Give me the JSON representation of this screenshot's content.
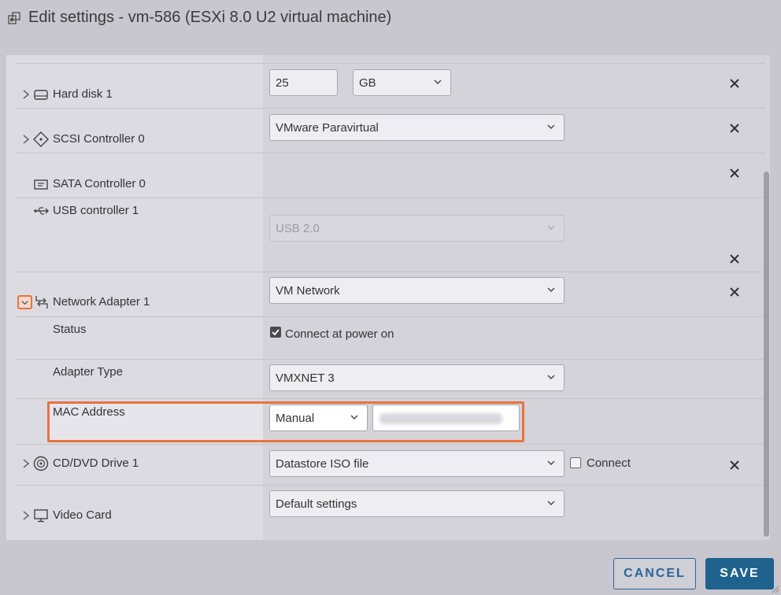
{
  "dialog": {
    "title": "Edit settings - vm-586 (ESXi 8.0 U2 virtual machine)"
  },
  "hard_disk": {
    "label": "Hard disk 1",
    "size_value": "25",
    "size_unit": "GB",
    "icon": "hard-disk-icon"
  },
  "scsi": {
    "label": "SCSI Controller 0",
    "type": "VMware Paravirtual",
    "icon": "scsi-controller-icon"
  },
  "sata": {
    "label": "SATA Controller 0",
    "icon": "sata-controller-icon"
  },
  "usb": {
    "label": "USB controller 1",
    "version": "USB 2.0",
    "icon": "usb-icon"
  },
  "network_adapter": {
    "label": "Network Adapter 1",
    "network": "VM Network",
    "icon": "network-adapter-icon",
    "status_label": "Status",
    "connect_label": "Connect at power on",
    "connect_checked": true,
    "adapter_type_label": "Adapter Type",
    "adapter_type": "VMXNET 3",
    "mac_label": "MAC Address",
    "mac_mode": "Manual"
  },
  "cd_dvd": {
    "label": "CD/DVD Drive 1",
    "source": "Datastore ISO file",
    "connect_label": "Connect",
    "connect_checked": false,
    "icon": "cd-dvd-icon"
  },
  "video_card": {
    "label": "Video Card",
    "settings": "Default settings",
    "icon": "monitor-icon"
  },
  "footer": {
    "cancel_label": "CANCEL",
    "save_label": "SAVE"
  },
  "colors": {
    "highlight": "#e8733f",
    "primary": "#1f628e"
  }
}
